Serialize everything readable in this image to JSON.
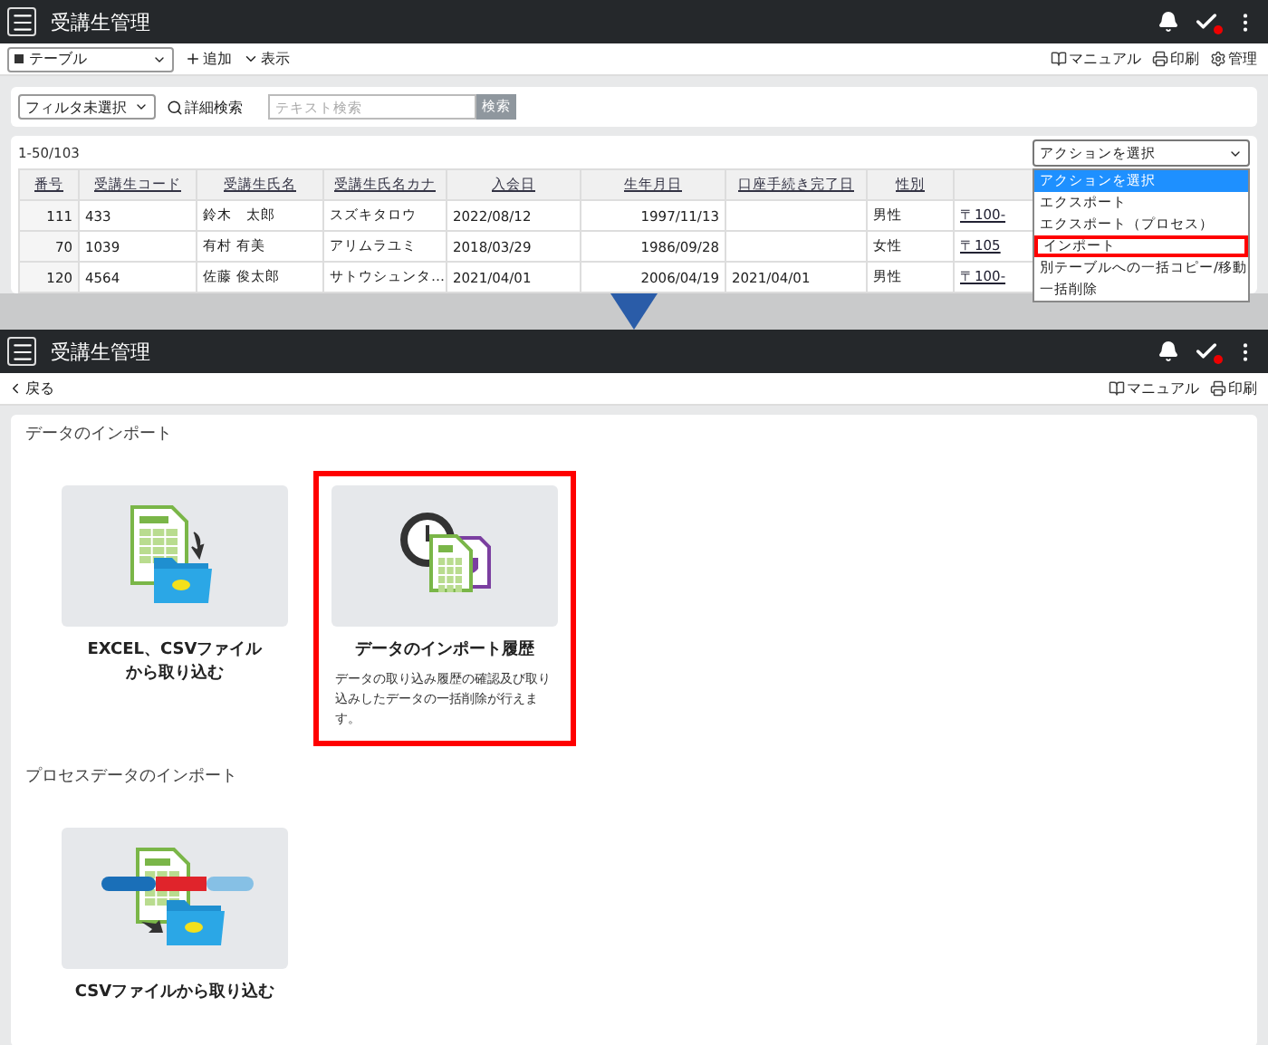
{
  "top_screen": {
    "header": {
      "title": "受講生管理"
    },
    "toolbar": {
      "view_select": "テーブル",
      "add": "追加",
      "display": "表示",
      "links": [
        {
          "kind": "manual",
          "label": "マニュアル"
        },
        {
          "kind": "print",
          "label": "印刷"
        },
        {
          "kind": "admin",
          "label": "管理"
        }
      ]
    },
    "filter": {
      "select": "フィルタ未選択",
      "detail_search": "詳細検索",
      "search": {
        "placeholder": "テキスト検索"
      },
      "search_button": "検索"
    },
    "count": "1-50/103",
    "action_select": "アクションを選択",
    "action_options": [
      {
        "label": "アクションを選択",
        "selected": true,
        "highlighted": false
      },
      {
        "label": "エクスポート",
        "selected": false,
        "highlighted": false
      },
      {
        "label": "エクスポート（プロセス）",
        "selected": false,
        "highlighted": false
      },
      {
        "label": "インポート",
        "selected": false,
        "highlighted": true
      },
      {
        "label": "別テーブルへの一括コピー/移動",
        "selected": false,
        "highlighted": false
      },
      {
        "label": "一括削除",
        "selected": false,
        "highlighted": false
      }
    ],
    "table": {
      "columns": [
        "番号",
        "受講生コード",
        "受講生氏名",
        "受講生氏名カナ",
        "入会日",
        "生年月日",
        "口座手続き完了日",
        "性別"
      ],
      "rows": [
        [
          "111",
          "433",
          "鈴木　太郎",
          "スズキタロウ",
          "2022/08/12",
          "1997/11/13",
          null,
          "男性",
          "〒100-"
        ],
        [
          "70",
          "1039",
          "有村 有美",
          "アリムラユミ",
          "2018/03/29",
          "1986/09/28",
          null,
          "女性",
          "〒105"
        ],
        [
          "120",
          "4564",
          "佐藤 俊太郎",
          "サトウシュンタ…",
          "2021/04/01",
          "2006/04/19",
          "2021/04/01",
          "男性",
          "〒100-"
        ]
      ]
    }
  },
  "bottom_screen": {
    "header": {
      "title": "受講生管理"
    },
    "back": "戻る",
    "links": [
      {
        "kind": "manual",
        "label": "マニュアル"
      },
      {
        "kind": "print",
        "label": "印刷"
      }
    ],
    "sections": [
      {
        "title": "データのインポート",
        "cards": [
          {
            "kind": "excel",
            "title": [
              "EXCEL、CSVファイル",
              "から取り込む"
            ],
            "highlighted": false
          },
          {
            "kind": "history",
            "title": [
              "データのインポート履歴"
            ],
            "description": "データの取り込み履歴の確認及び取り込みしたデータの一括削除が行えます。",
            "highlighted": true
          }
        ]
      },
      {
        "title": "プロセスデータのインポート",
        "cards": [
          {
            "kind": "process",
            "title": [
              "CSVファイルから取り込む"
            ],
            "highlighted": false
          }
        ]
      }
    ]
  }
}
